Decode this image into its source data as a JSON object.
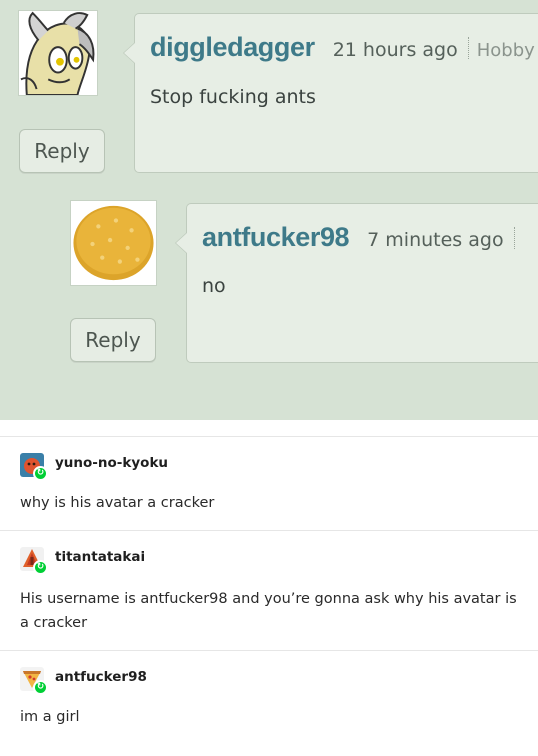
{
  "forum": {
    "comments": [
      {
        "username": "diggledagger",
        "time": "21 hours ago",
        "role": "Hobby",
        "body": "Stop fucking ants",
        "reply_label": "Reply",
        "avatar_icon": "pony-avatar-icon"
      },
      {
        "username": "antfucker98",
        "time": "7 minutes ago",
        "role": "",
        "body": "no",
        "reply_label": "Reply",
        "avatar_icon": "cracker-avatar-icon"
      }
    ],
    "colors": {
      "background": "#d6e2d4",
      "bubble": "#e7eee5",
      "username": "#3e7a89"
    }
  },
  "notes": [
    {
      "username": "yuno-no-kyoku",
      "text": "why is his avatar a cracker",
      "avatar_icon": "orange-blob-avatar-icon",
      "badge_icon": "reblog-icon"
    },
    {
      "username": "titantatakai",
      "text": "His username is antfucker98 and you’re gonna ask why his avatar is a cracker",
      "avatar_icon": "titan-avatar-icon",
      "badge_icon": "reblog-icon"
    },
    {
      "username": "antfucker98",
      "text": "im a girl",
      "avatar_icon": "pizza-slice-avatar-icon",
      "badge_icon": "reblog-icon"
    }
  ],
  "colors": {
    "reblog_badge": "#00cf35",
    "divider": "#e6e6e6"
  }
}
